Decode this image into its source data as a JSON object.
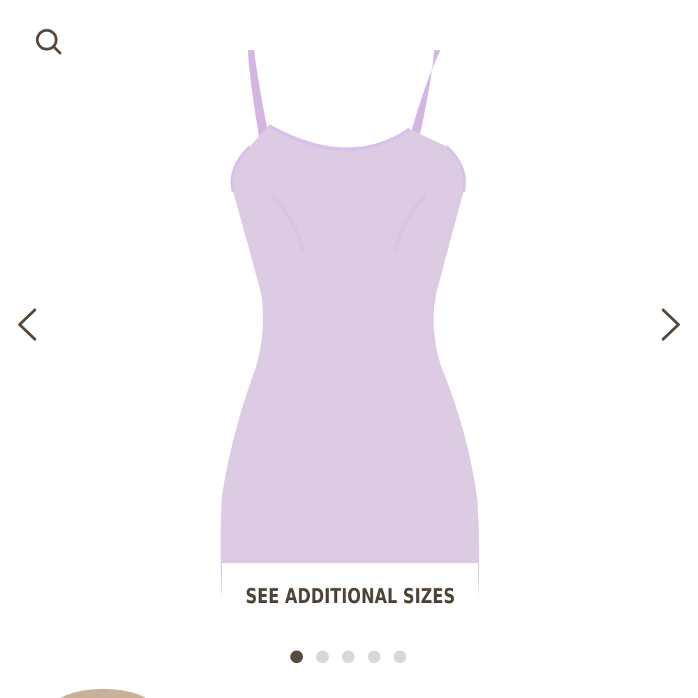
{
  "header": {
    "search_icon": "search-icon"
  },
  "gallery": {
    "prev_icon": "chevron-left-icon",
    "next_icon": "chevron-right-icon",
    "product_image": {
      "subject": "lavender slip dress",
      "color": "#dccbe2"
    },
    "see_sizes_label": "SEE ADDITIONAL SIZES",
    "pagination": {
      "total": 5,
      "active": 1,
      "active_color": "#5a4a3c",
      "inactive_color": "#d8d8d8"
    }
  },
  "colors": {
    "icon": "#5a4a3c",
    "label": "#4f4539",
    "thumb": "#c7b199"
  }
}
